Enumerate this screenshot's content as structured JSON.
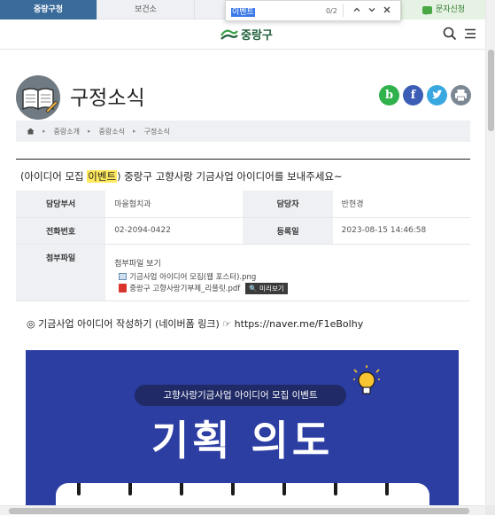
{
  "top_tabs": [
    "중랑구청",
    "보건소"
  ],
  "top_tab_sms": "문자신청",
  "find_bar": {
    "query": "이벤트",
    "count": "0/2",
    "prev": "∧",
    "next": "∨",
    "close": "✕"
  },
  "header": {
    "logo_text": "중랑구"
  },
  "page_title": "구정소식",
  "share_icons": [
    "blog-icon",
    "facebook-icon",
    "twitter-icon",
    "print-icon"
  ],
  "breadcrumb": {
    "items": [
      "중랑소개",
      "중랑소식",
      "구정소식"
    ]
  },
  "post": {
    "title_before": "(아이디어 모집 ",
    "title_highlight": "이벤트",
    "title_after": ") 중랑구 고향사랑 기금사업 아이디어를 보내주세요~"
  },
  "info": {
    "dept_label": "담당부서",
    "dept": "마을협치과",
    "manager_label": "담당자",
    "manager": "반현경",
    "phone_label": "전화번호",
    "phone": "02-2094-0422",
    "date_label": "등록일",
    "date": "2023-08-15 14:46:58",
    "attach_label": "첨부파일",
    "attach_title": "첨부파일 보기",
    "files": [
      "기금사업 아이디어 모집(웹 포스터).png",
      "중랑구 고향사랑기부제_리플릿.pdf"
    ],
    "preview_label": "🔍 미리보기"
  },
  "link_line": "◎ 기금사업 아이디어 작성하기 (네이버폼 링크) ☞ https://naver.me/F1eBolhy",
  "banner": {
    "pill": "고향사랑기금사업 아이디어 모집 이벤트",
    "heading": "기획 의도"
  },
  "colors": {
    "accent": "#3a6b9a",
    "highlight": "#ffe95c",
    "banner": "#2d3ea3"
  }
}
